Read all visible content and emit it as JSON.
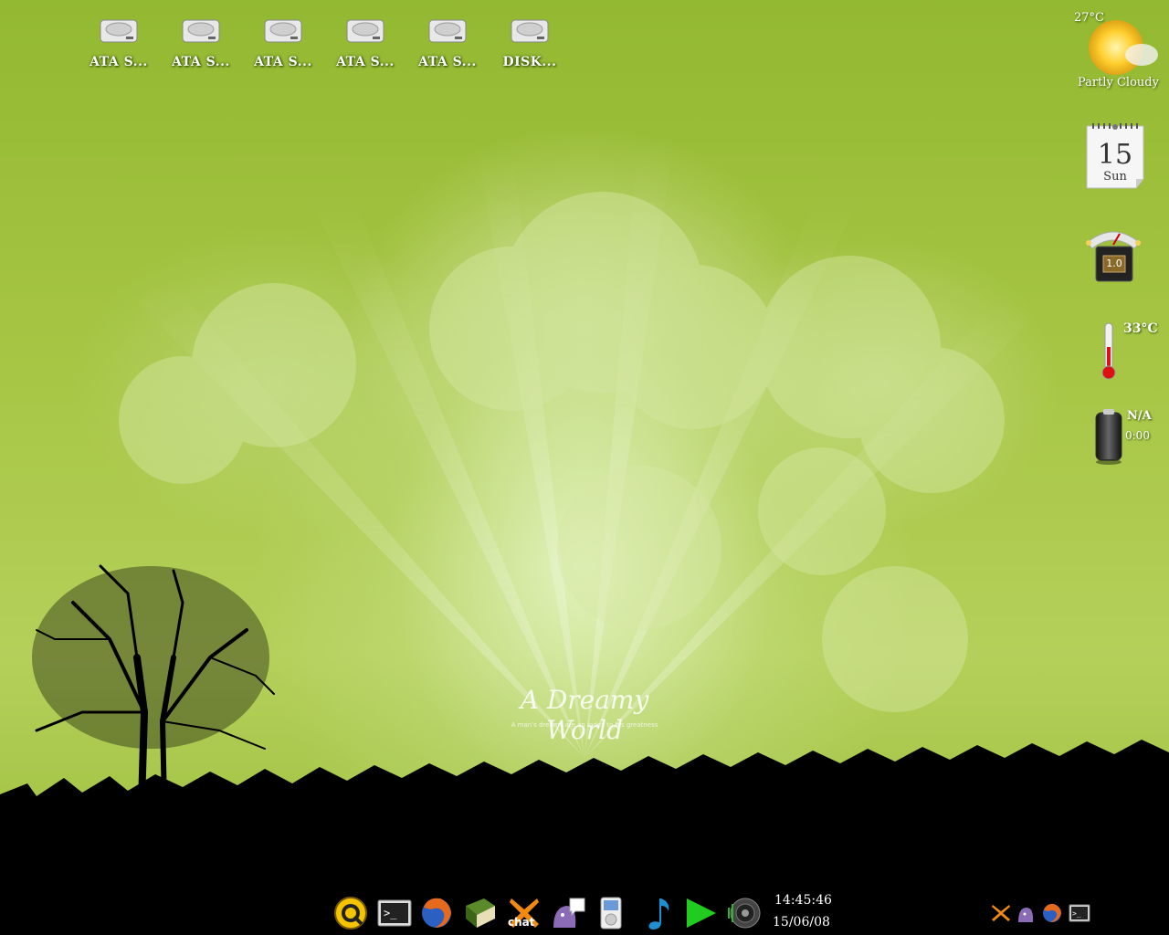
{
  "desktop": {
    "icons": [
      {
        "label": "ATA S..."
      },
      {
        "label": "ATA S..."
      },
      {
        "label": "ATA S..."
      },
      {
        "label": "ATA S..."
      },
      {
        "label": "ATA S..."
      },
      {
        "label": "DISK..."
      }
    ],
    "wallpaper": {
      "title": "A Dreamy World",
      "subtitle": "A man's dreams are an index to his greatness"
    }
  },
  "widgets": {
    "weather": {
      "temperature": "27°C",
      "condition": "Partly Cloudy"
    },
    "calendar": {
      "day": "15",
      "weekday": "Sun"
    },
    "cpu_meter": {
      "value": "1.0"
    },
    "thermometer": {
      "temperature": "33°C"
    },
    "battery": {
      "status": "N/A",
      "time": "0:00"
    }
  },
  "taskbar": {
    "launchers": [
      "system-menu-icon",
      "terminal-icon",
      "firefox-icon",
      "book-icon",
      "xchat-icon",
      "pidgin-icon",
      "ipod-icon",
      "music-note-icon",
      "play-icon",
      "speaker-icon"
    ],
    "clock": {
      "time": "14:45:46",
      "date": "15/06/08"
    },
    "tray": [
      "xchat-tray-icon",
      "pidgin-tray-icon",
      "firefox-tray-icon",
      "terminal-tray-icon"
    ]
  },
  "colors": {
    "accent": "#8fb32a",
    "taskbar": "#000000",
    "text": "#ffffff"
  }
}
